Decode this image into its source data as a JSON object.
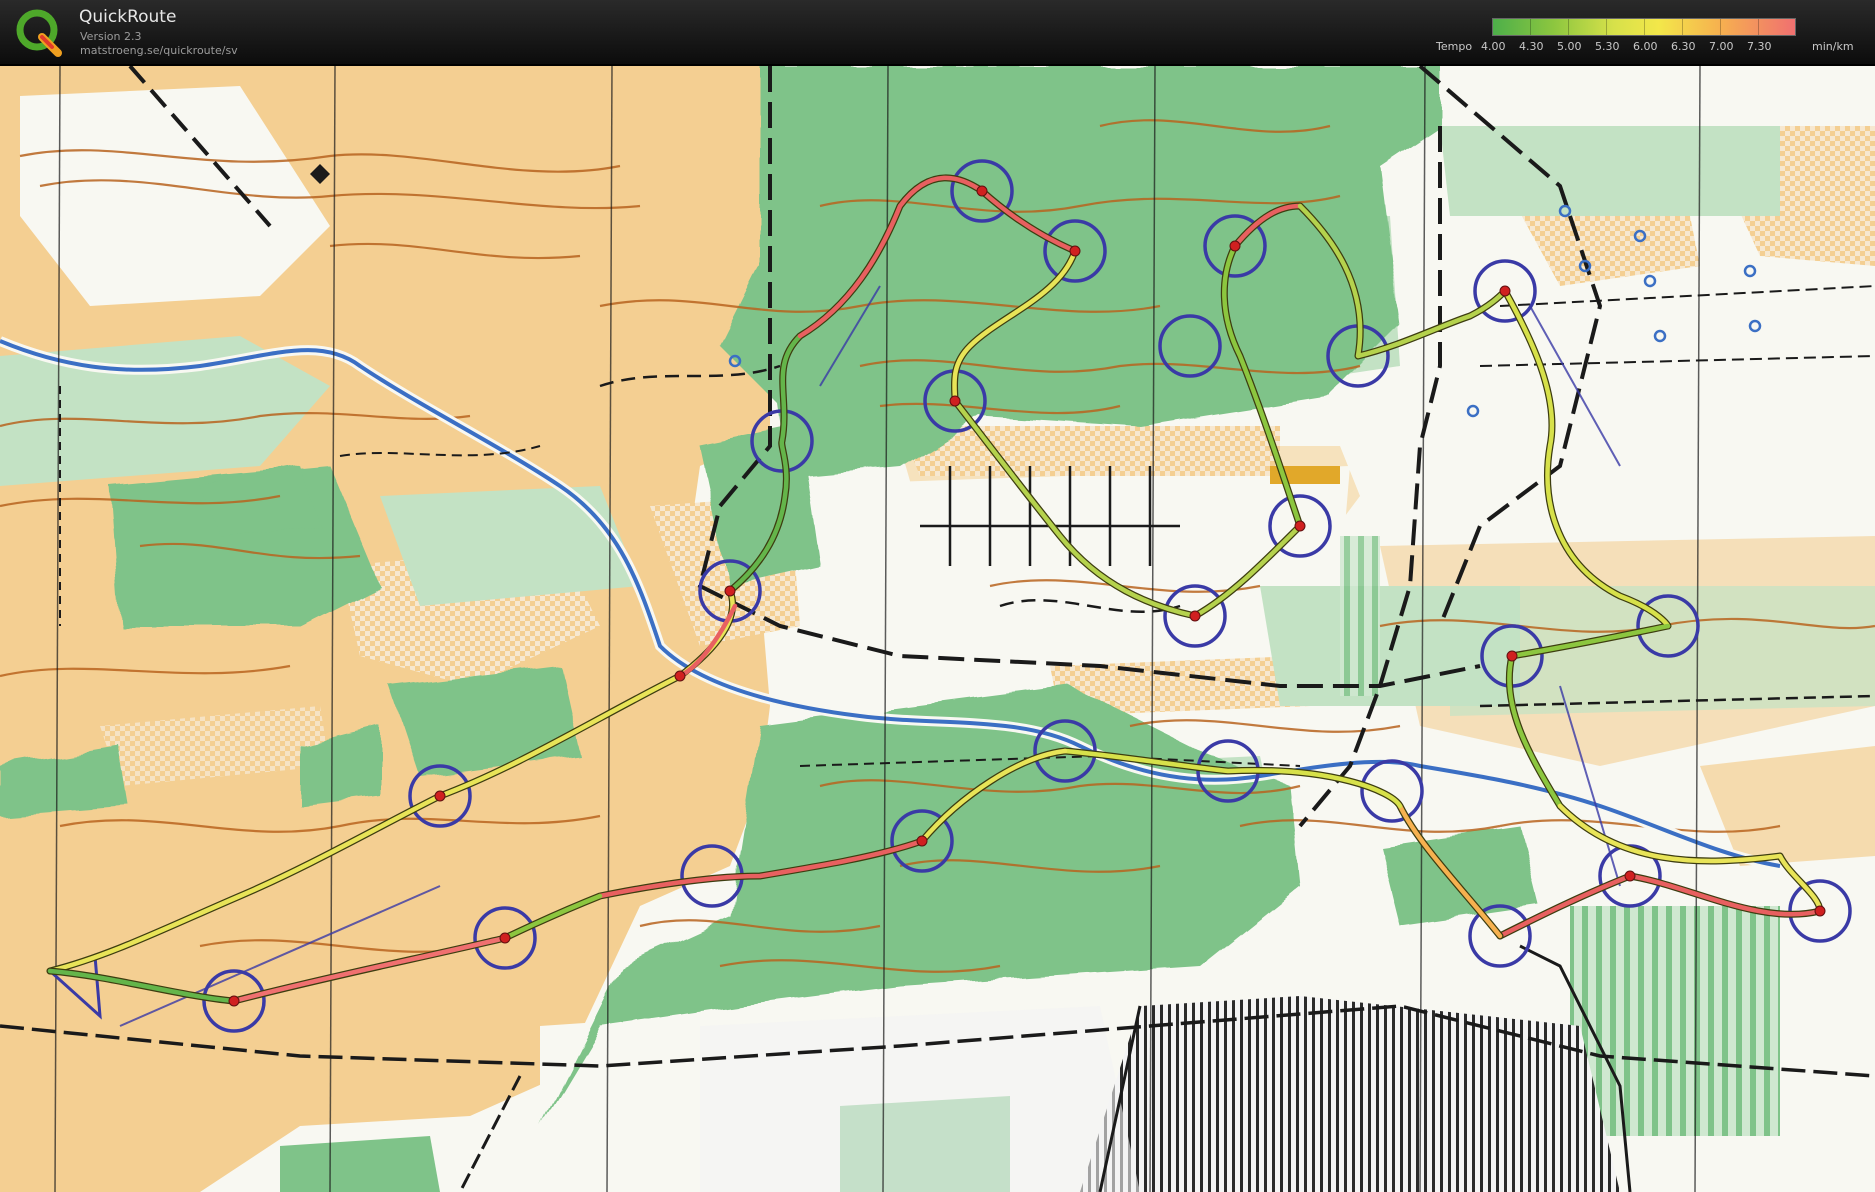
{
  "app": {
    "title": "QuickRoute",
    "version": "Version 2.3",
    "url": "matstroeng.se/quickroute/sv"
  },
  "legend": {
    "prefix": "Tempo",
    "labels": [
      "4.00",
      "4.30",
      "5.00",
      "5.30",
      "6.00",
      "6.30",
      "7.00",
      "7.30"
    ],
    "unit": "min/km",
    "colors": [
      "#4daf4a",
      "#8cc63f",
      "#d7e14a",
      "#f3e74a",
      "#f6b14f",
      "#f07070"
    ]
  },
  "map": {
    "colors": {
      "open_land": "#f4cf92",
      "forest_green": "#7fc389",
      "light_green": "#c3e2c4",
      "white_forest": "#f8f8f2",
      "contour": "#b8641f",
      "water": "#3b6fc4",
      "control_circle": "#3a3aa6",
      "road": "#1a1a1a",
      "urban": "#e9e9e9"
    }
  }
}
